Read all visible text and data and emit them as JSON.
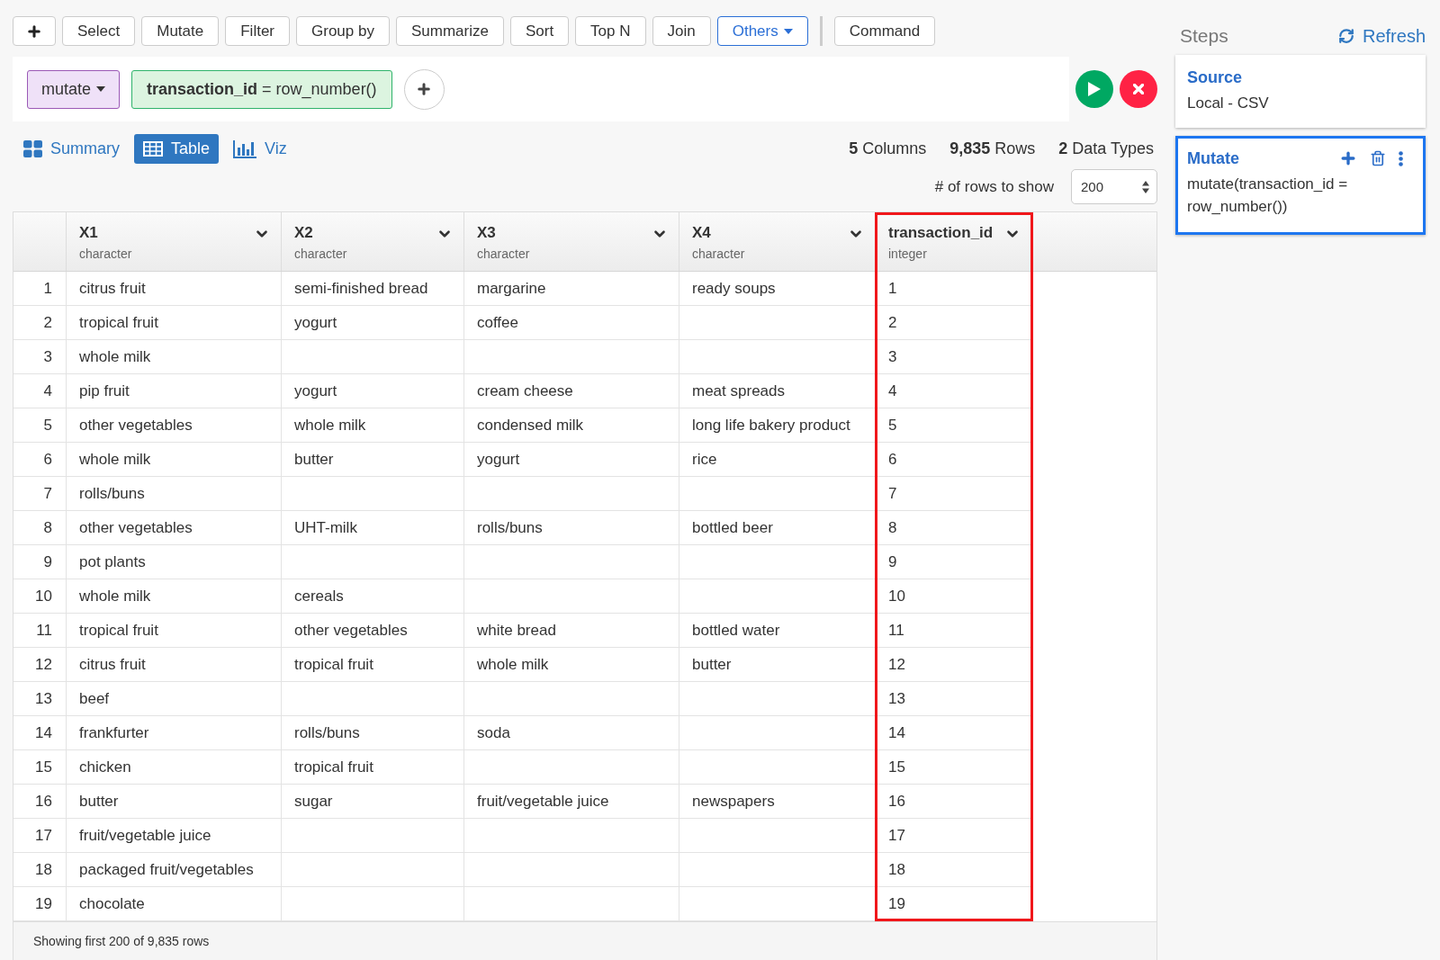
{
  "toolbar": {
    "items": [
      {
        "kind": "add"
      },
      {
        "kind": "plain",
        "label": "Select"
      },
      {
        "kind": "plain",
        "label": "Mutate"
      },
      {
        "kind": "plain",
        "label": "Filter"
      },
      {
        "kind": "plain",
        "label": "Group by"
      },
      {
        "kind": "plain",
        "label": "Summarize"
      },
      {
        "kind": "plain",
        "label": "Sort"
      },
      {
        "kind": "plain",
        "label": "Top N"
      },
      {
        "kind": "plain",
        "label": "Join"
      },
      {
        "kind": "menu",
        "label": "Others"
      },
      {
        "kind": "divider"
      },
      {
        "kind": "plain",
        "label": "Command"
      }
    ]
  },
  "command_bar": {
    "verb": "mutate",
    "expression": "**transaction_id** = row_number()"
  },
  "view_tabs": [
    {
      "kind": "summary",
      "label": "Summary",
      "selected": false
    },
    {
      "kind": "table",
      "label": "Table",
      "selected": true
    },
    {
      "kind": "viz",
      "label": "Viz",
      "selected": false
    }
  ],
  "stats": [
    "**5** Columns",
    "**9,835** Rows",
    "**2** Data Types"
  ],
  "rows_to_show": {
    "label": "# of rows to show",
    "value": "200"
  },
  "table": {
    "columns": [
      {
        "name": "X1",
        "type": "character",
        "highlighted": false
      },
      {
        "name": "X2",
        "type": "character",
        "highlighted": false
      },
      {
        "name": "X3",
        "type": "character",
        "highlighted": false
      },
      {
        "name": "X4",
        "type": "character",
        "highlighted": false
      },
      {
        "name": "transaction_id",
        "type": "integer",
        "highlighted": true
      }
    ],
    "rows": [
      {
        "number": "1",
        "cells": [
          "citrus fruit",
          "semi-finished bread",
          "margarine",
          "ready soups",
          "1"
        ]
      },
      {
        "number": "2",
        "cells": [
          "tropical fruit",
          "yogurt",
          "coffee",
          null,
          "2"
        ]
      },
      {
        "number": "3",
        "cells": [
          "whole milk",
          null,
          null,
          null,
          "3"
        ]
      },
      {
        "number": "4",
        "cells": [
          "pip fruit",
          "yogurt",
          "cream cheese",
          "meat spreads",
          "4"
        ]
      },
      {
        "number": "5",
        "cells": [
          "other vegetables",
          "whole milk",
          "condensed milk",
          "long life bakery product",
          "5"
        ]
      },
      {
        "number": "6",
        "cells": [
          "whole milk",
          "butter",
          "yogurt",
          "rice",
          "6"
        ]
      },
      {
        "number": "7",
        "cells": [
          "rolls/buns",
          null,
          null,
          null,
          "7"
        ]
      },
      {
        "number": "8",
        "cells": [
          "other vegetables",
          "UHT-milk",
          "rolls/buns",
          "bottled beer",
          "8"
        ]
      },
      {
        "number": "9",
        "cells": [
          "pot plants",
          null,
          null,
          null,
          "9"
        ]
      },
      {
        "number": "10",
        "cells": [
          "whole milk",
          "cereals",
          null,
          null,
          "10"
        ]
      },
      {
        "number": "11",
        "cells": [
          "tropical fruit",
          "other vegetables",
          "white bread",
          "bottled water",
          "11"
        ]
      },
      {
        "number": "12",
        "cells": [
          "citrus fruit",
          "tropical fruit",
          "whole milk",
          "butter",
          "12"
        ]
      },
      {
        "number": "13",
        "cells": [
          "beef",
          null,
          null,
          null,
          "13"
        ]
      },
      {
        "number": "14",
        "cells": [
          "frankfurter",
          "rolls/buns",
          "soda",
          null,
          "14"
        ]
      },
      {
        "number": "15",
        "cells": [
          "chicken",
          "tropical fruit",
          null,
          null,
          "15"
        ]
      },
      {
        "number": "16",
        "cells": [
          "butter",
          "sugar",
          "fruit/vegetable juice",
          "newspapers",
          "16"
        ]
      },
      {
        "number": "17",
        "cells": [
          "fruit/vegetable juice",
          null,
          null,
          null,
          "17"
        ]
      },
      {
        "number": "18",
        "cells": [
          "packaged fruit/vegetables",
          null,
          null,
          null,
          "18"
        ]
      },
      {
        "number": "19",
        "cells": [
          "chocolate",
          null,
          null,
          null,
          "19"
        ]
      }
    ],
    "footer": "Showing first 200 of 9,835 rows"
  },
  "steps": {
    "title": "Steps",
    "refresh": "Refresh",
    "items": [
      {
        "title": "Source",
        "detail": "Local - CSV",
        "selected": false
      },
      {
        "title": "Mutate",
        "detail": "mutate(transaction_id = row_number())",
        "selected": true
      }
    ]
  }
}
